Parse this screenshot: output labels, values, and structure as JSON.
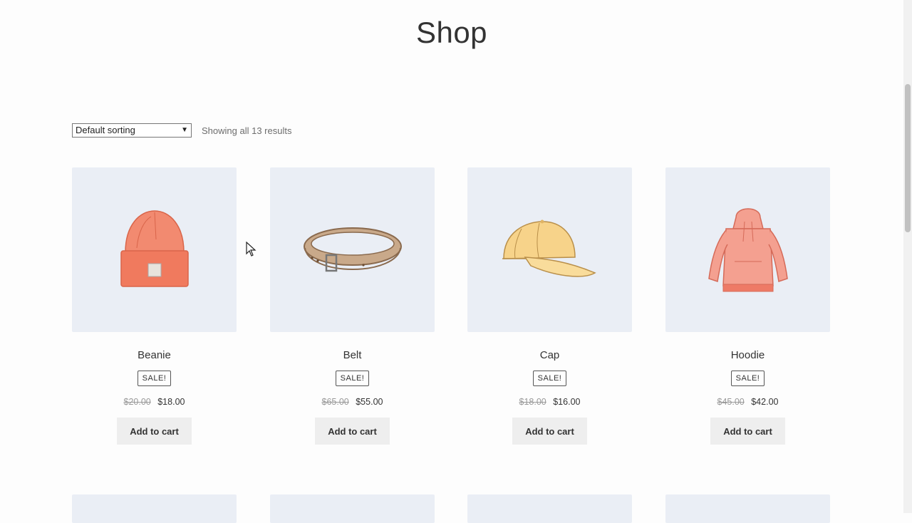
{
  "page": {
    "title": "Shop"
  },
  "toolbar": {
    "sort_label": "Default sorting",
    "result_count": "Showing all 13 results"
  },
  "products": [
    {
      "name": "Beanie",
      "badge": "SALE!",
      "old_price": "$20.00",
      "new_price": "$18.00",
      "button": "Add to cart",
      "image": "beanie-image"
    },
    {
      "name": "Belt",
      "badge": "SALE!",
      "old_price": "$65.00",
      "new_price": "$55.00",
      "button": "Add to cart",
      "image": "belt-image"
    },
    {
      "name": "Cap",
      "badge": "SALE!",
      "old_price": "$18.00",
      "new_price": "$16.00",
      "button": "Add to cart",
      "image": "cap-image"
    },
    {
      "name": "Hoodie",
      "badge": "SALE!",
      "old_price": "$45.00",
      "new_price": "$42.00",
      "button": "Add to cart",
      "image": "hoodie-image"
    }
  ],
  "colors": {
    "thumb_bg": "#eaeef5",
    "button_bg": "#eeeeee"
  }
}
